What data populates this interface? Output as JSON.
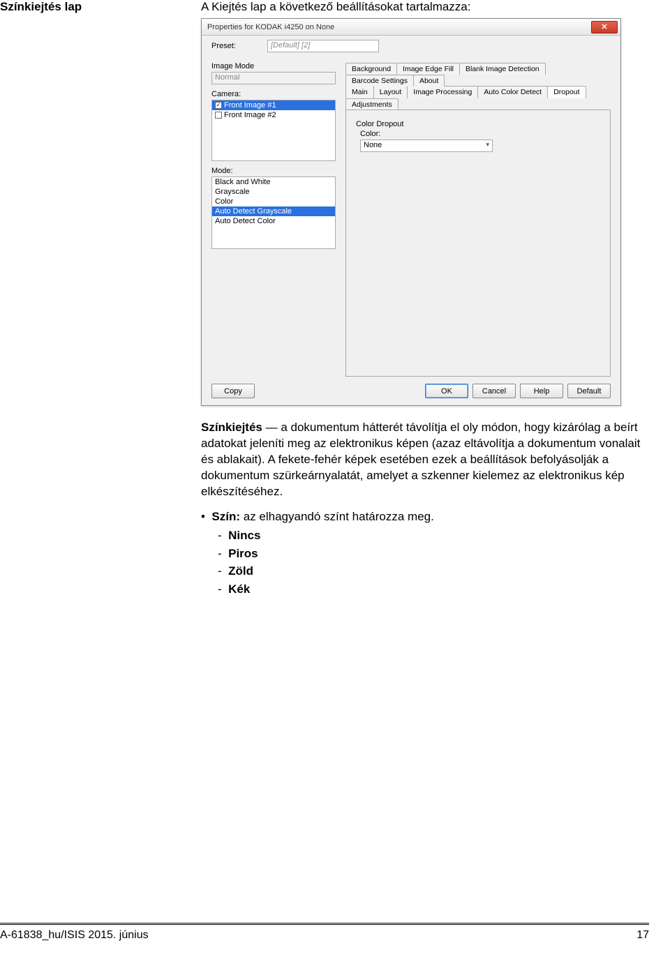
{
  "doc": {
    "section_title": "Színkiejtés lap",
    "intro": "A Kiejtés lap a következő beállításokat tartalmazza:",
    "paragraph_lead": "Színkiejtés",
    "paragraph_body": " — a dokumentum hátterét távolítja el oly módon, hogy kizárólag a beírt adatokat jeleníti meg az elektronikus képen (azaz eltávolítja a dokumentum vonalait és ablakait). A fekete-fehér képek esetében ezek a beállítások befolyásolják a dokumentum szürkeárnyalatát, amelyet a szkenner kielemez az elektronikus kép elkészítéséhez.",
    "bullet_label": "Szín:",
    "bullet_rest": " az elhagyandó színt határozza meg.",
    "options": [
      "Nincs",
      "Piros",
      "Zöld",
      "Kék"
    ],
    "footer_left": "A-61838_hu/ISIS  2015. június",
    "footer_right": "17"
  },
  "dialog": {
    "title": "Properties for KODAK i4250 on None",
    "preset_label": "Preset:",
    "preset_value": "[Default] [2]",
    "imagemode_label": "Image Mode",
    "imagemode_value": "Normal",
    "camera_label": "Camera:",
    "camera_items": [
      {
        "label": "Front Image #1",
        "checked": true,
        "selected": true
      },
      {
        "label": "Front Image #2",
        "checked": false,
        "selected": false
      }
    ],
    "mode_label": "Mode:",
    "mode_items": [
      {
        "label": "Black and White",
        "selected": false
      },
      {
        "label": "Grayscale",
        "selected": false
      },
      {
        "label": "Color",
        "selected": false
      },
      {
        "label": "Auto Detect Grayscale",
        "selected": true
      },
      {
        "label": "Auto Detect Color",
        "selected": false
      }
    ],
    "tabs_row1": [
      "Background",
      "Image Edge Fill",
      "Blank Image Detection",
      "Barcode Settings",
      "About"
    ],
    "tabs_row2": [
      "Main",
      "Layout",
      "Image Processing",
      "Auto Color Detect",
      "Dropout",
      "Adjustments"
    ],
    "active_tab": "Dropout",
    "dropout_section": "Color Dropout",
    "color_label": "Color:",
    "color_value": "None",
    "buttons": {
      "copy": "Copy",
      "ok": "OK",
      "cancel": "Cancel",
      "help": "Help",
      "default": "Default"
    }
  }
}
